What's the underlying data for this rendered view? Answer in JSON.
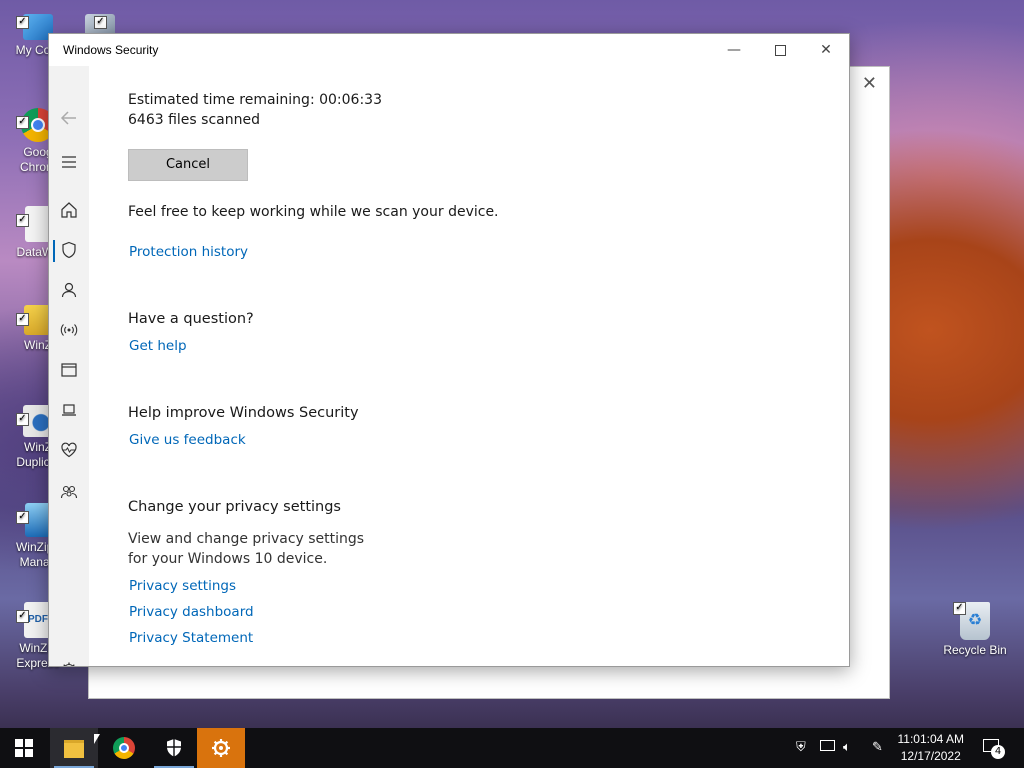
{
  "desktop": {
    "icons": [
      {
        "label": "My Com"
      },
      {
        "label": "Goog Chrom"
      },
      {
        "label": "DataWa"
      },
      {
        "label": "WinZ"
      },
      {
        "label": "WinZ Duplicat"
      },
      {
        "label": "WinZip I Manag"
      },
      {
        "label": "WinZip Express"
      },
      {
        "label": "Recycle Bin"
      }
    ]
  },
  "window": {
    "title": "Windows Security",
    "scan": {
      "time_remaining": "Estimated time remaining: 00:06:33",
      "files_scanned": "6463  files scanned",
      "cancel_label": "Cancel",
      "keep_working": "Feel free to keep working while we scan your device.",
      "protection_history": "Protection history"
    },
    "question": {
      "heading": "Have a question?",
      "link": "Get help"
    },
    "improve": {
      "heading": "Help improve Windows Security",
      "link": "Give us feedback"
    },
    "privacy": {
      "heading": "Change your privacy settings",
      "desc1": "View and change privacy settings",
      "desc2": "for your Windows 10 device.",
      "link1": "Privacy settings",
      "link2": "Privacy dashboard",
      "link3": "Privacy Statement"
    }
  },
  "taskbar": {
    "time": "11:01:04 AM",
    "date": "12/17/2022",
    "notification_count": "4"
  },
  "colors": {
    "link": "#0067b8",
    "taskbar": "#0f0f12",
    "active_app": "#d9730d"
  }
}
